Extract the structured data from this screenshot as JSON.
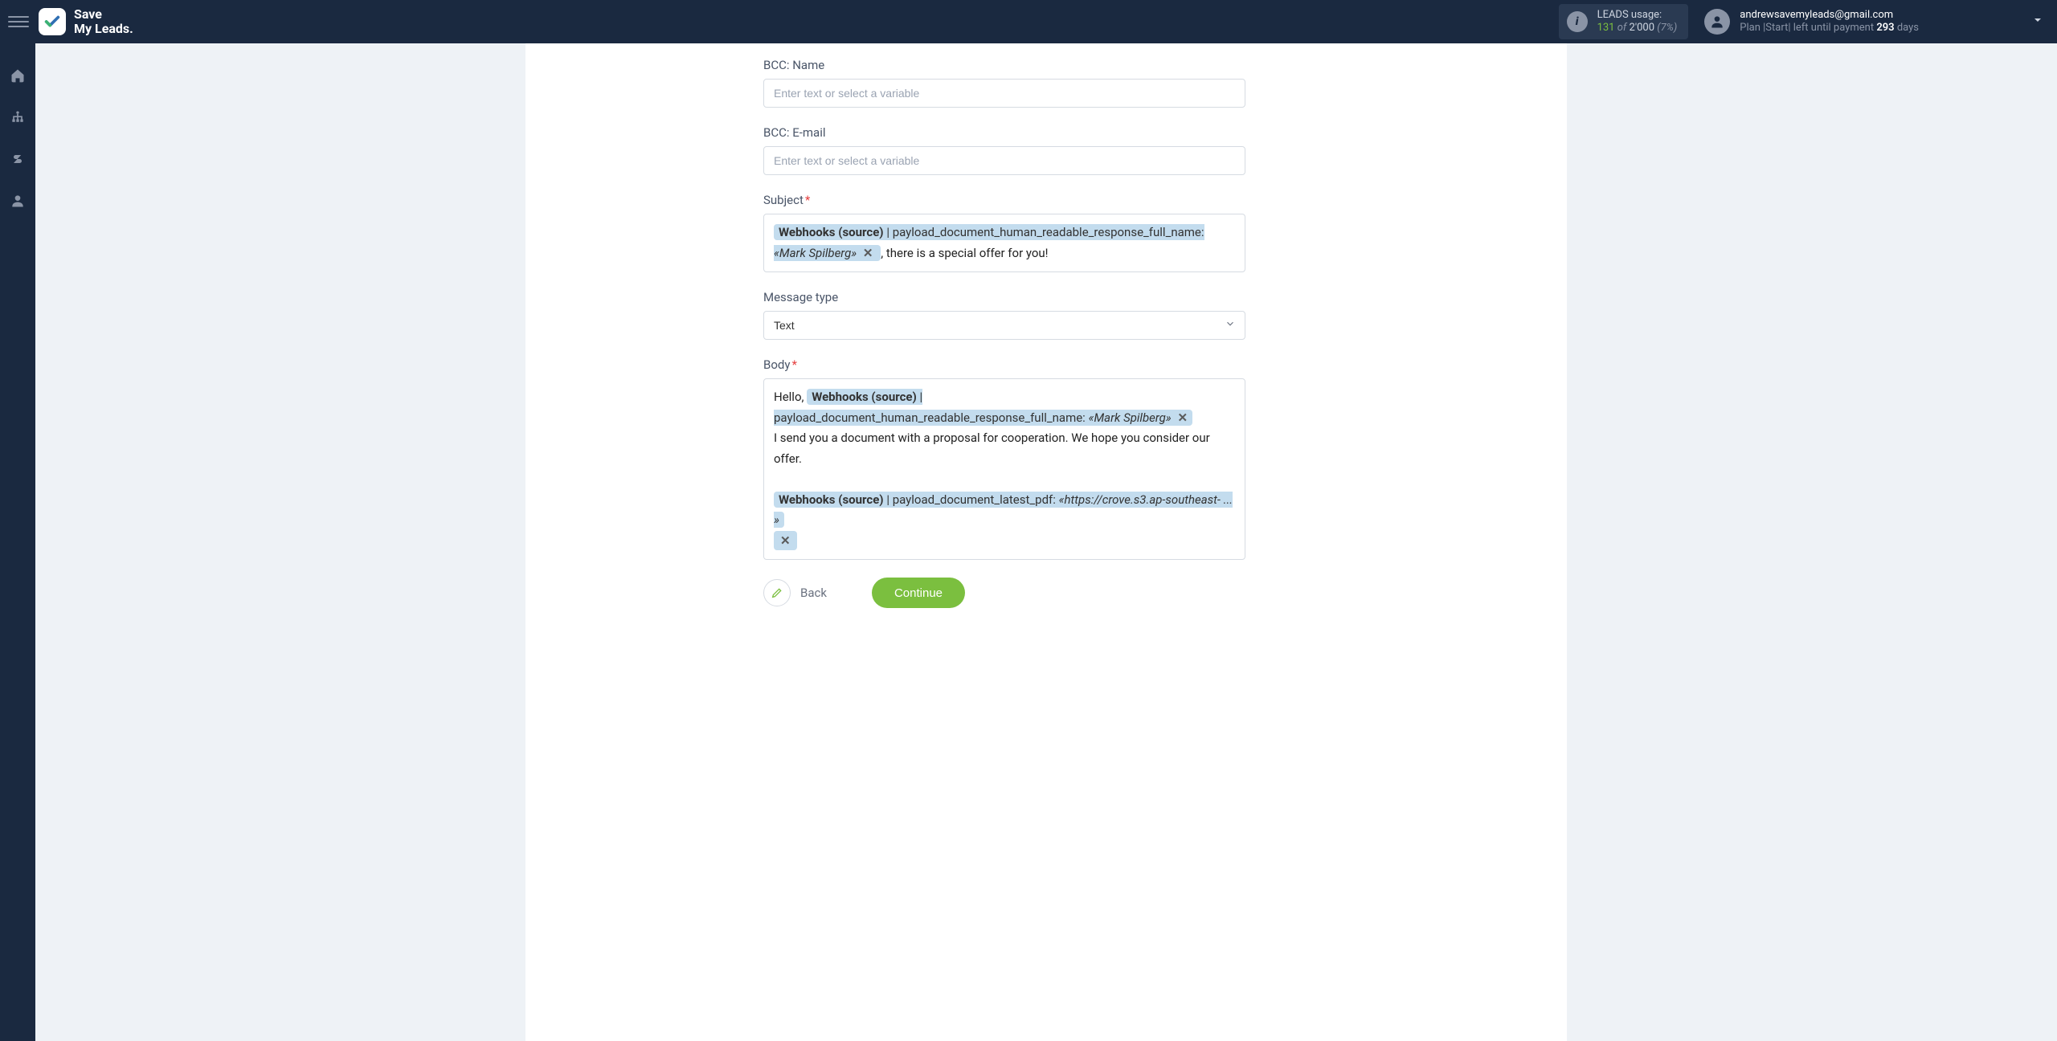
{
  "brand": {
    "line1": "Save",
    "line2": "My Leads"
  },
  "usage": {
    "label": "LEADS usage:",
    "used": "131",
    "of": "of",
    "total": "2'000",
    "pct": "(7%)"
  },
  "account": {
    "email": "andrewsavemyleads@gmail.com",
    "plan_prefix": "Plan |Start| left until payment ",
    "days": "293",
    "days_suffix": " days"
  },
  "form": {
    "bcc_name": {
      "label": "BCC: Name",
      "placeholder": "Enter text or select a variable"
    },
    "bcc_email": {
      "label": "BCC: E-mail",
      "placeholder": "Enter text or select a variable"
    },
    "subject": {
      "label": "Subject",
      "chip_source": "Webhooks (source)",
      "chip_field": "payload_document_human_readable_response_full_name:",
      "chip_value": "«Mark Spilberg»",
      "trailing": ", there is a special offer for you!"
    },
    "message_type": {
      "label": "Message type",
      "value": "Text"
    },
    "body": {
      "label": "Body",
      "greeting": "Hello, ",
      "chip1_source": "Webhooks (source)",
      "chip1_field": "payload_document_human_readable_response_full_name:",
      "chip1_value": "«Mark Spilberg»",
      "para": "I send you a document with a proposal for cooperation. We hope you consider our offer.",
      "chip2_source": "Webhooks (source)",
      "chip2_field": "payload_document_latest_pdf:",
      "chip2_value": "«https://crove.s3.ap-southeast- ... »"
    },
    "actions": {
      "back": "Back",
      "continue": "Continue"
    }
  }
}
